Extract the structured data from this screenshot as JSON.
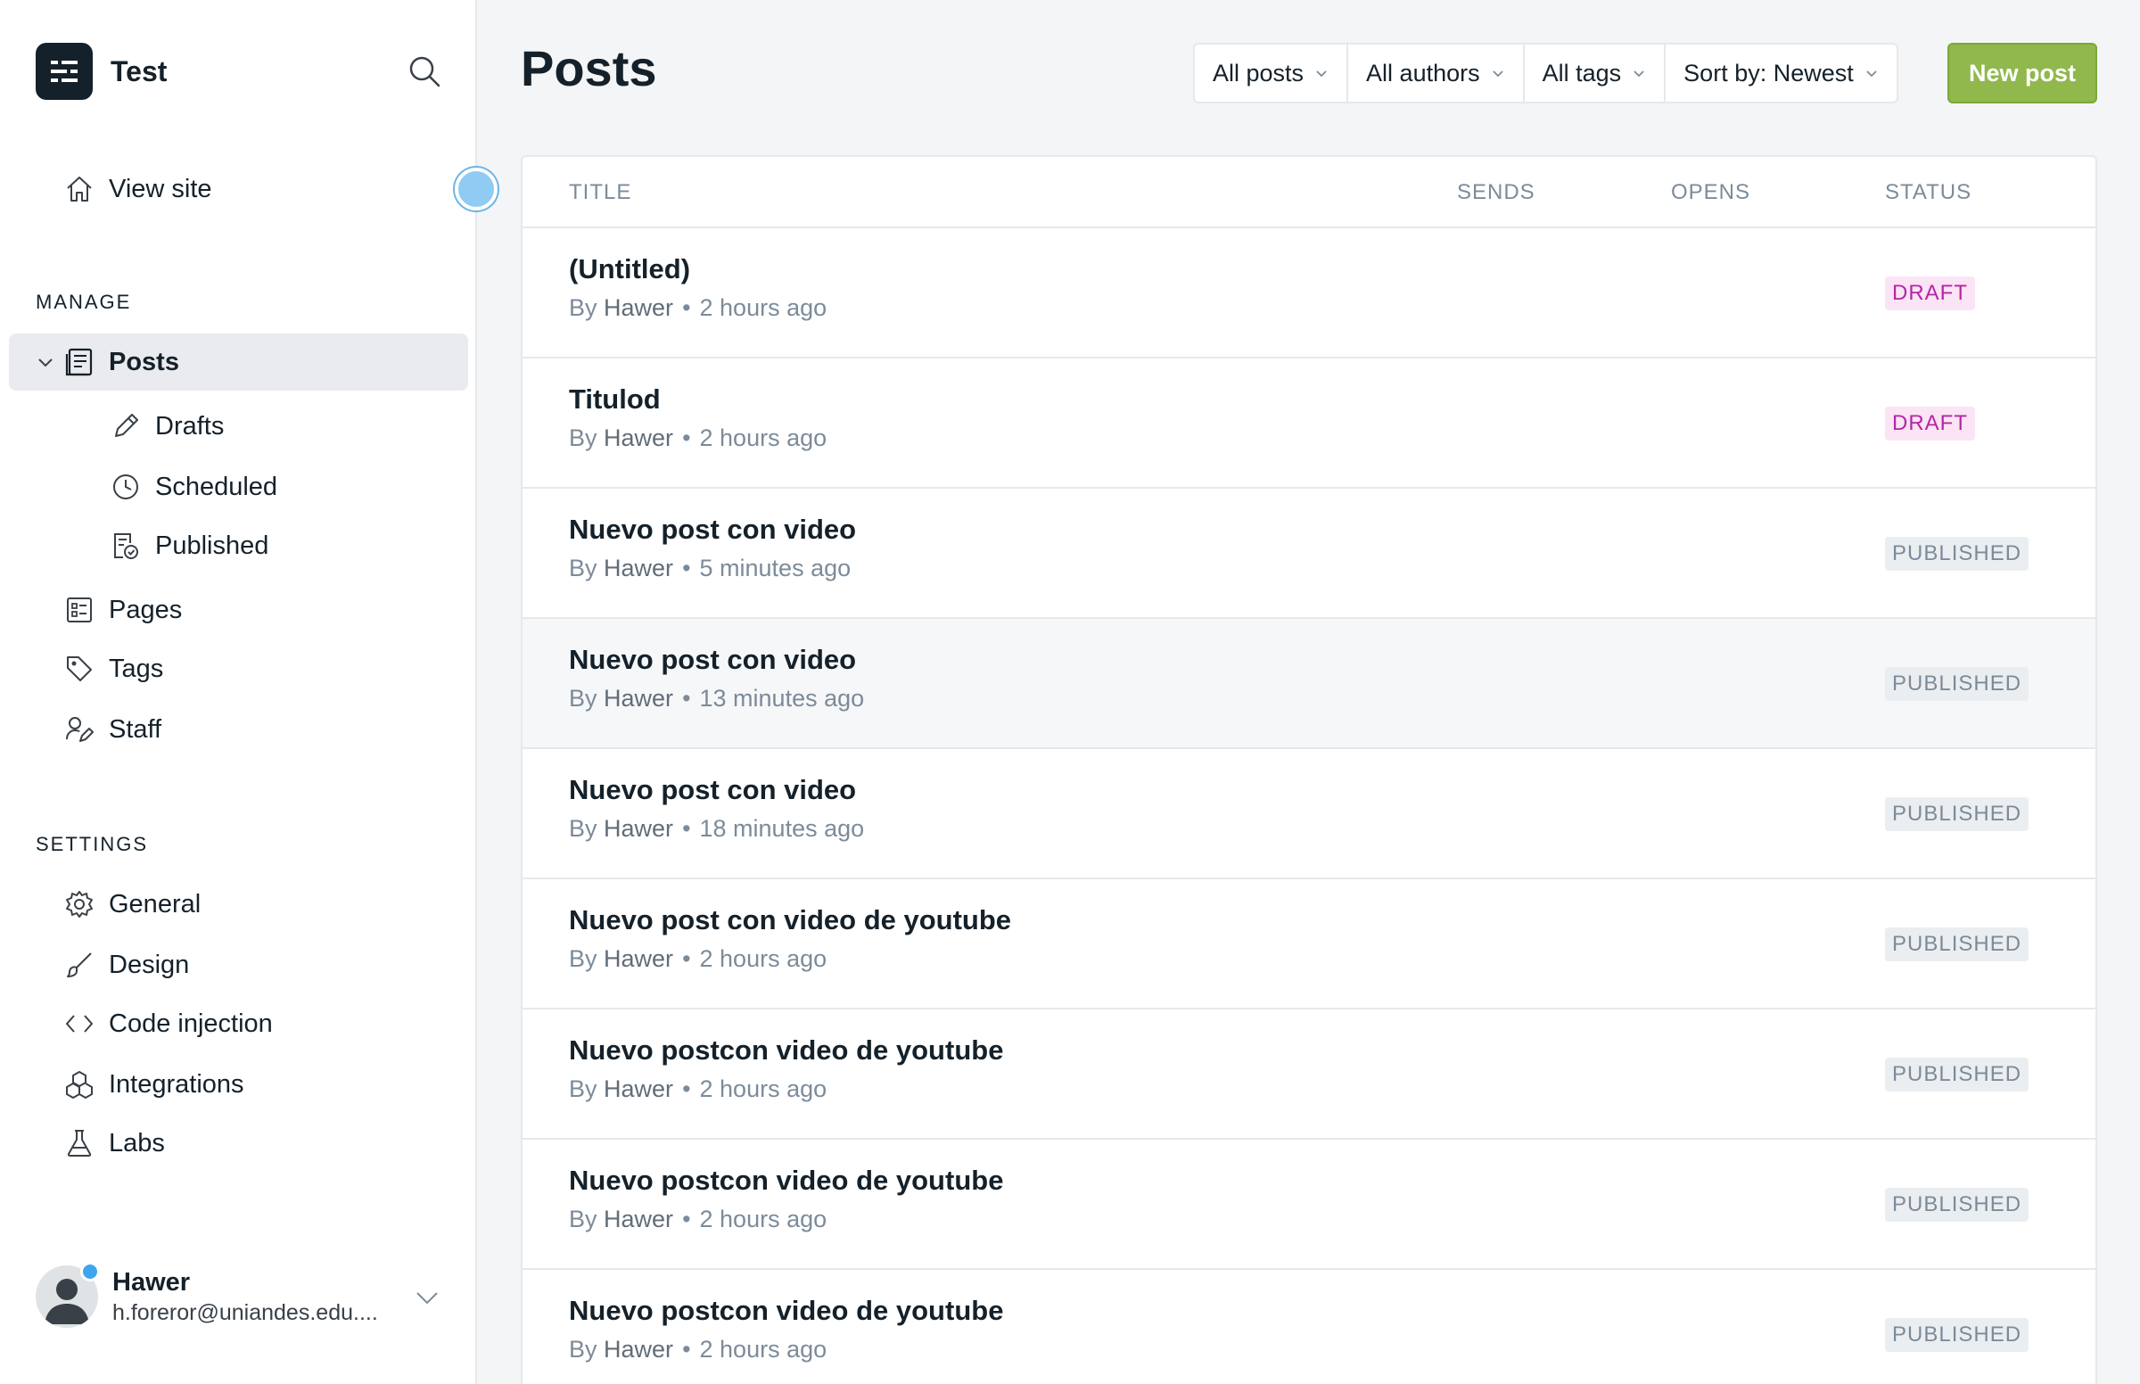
{
  "brand": {
    "name": "Test"
  },
  "nav": {
    "view_site": "View site",
    "manage_label": "MANAGE",
    "posts": "Posts",
    "drafts": "Drafts",
    "scheduled": "Scheduled",
    "published": "Published",
    "pages": "Pages",
    "tags": "Tags",
    "staff": "Staff",
    "settings_label": "SETTINGS",
    "general": "General",
    "design": "Design",
    "code_injection": "Code injection",
    "integrations": "Integrations",
    "labs": "Labs"
  },
  "user": {
    "name": "Hawer",
    "email": "h.foreror@uniandes.edu...."
  },
  "header": {
    "title": "Posts",
    "filters": [
      "All posts",
      "All authors",
      "All tags",
      "Sort by: Newest"
    ],
    "new_post": "New post"
  },
  "table": {
    "columns": [
      "TITLE",
      "SENDS",
      "OPENS",
      "STATUS"
    ],
    "rows": [
      {
        "title": "(Untitled)",
        "by": "By",
        "author": "Hawer",
        "time": "2 hours ago",
        "status": "DRAFT"
      },
      {
        "title": "Titulod",
        "by": "By",
        "author": "Hawer",
        "time": "2 hours ago",
        "status": "DRAFT"
      },
      {
        "title": "Nuevo post con video",
        "by": "By",
        "author": "Hawer",
        "time": "5 minutes ago",
        "status": "PUBLISHED"
      },
      {
        "title": "Nuevo post con video",
        "by": "By",
        "author": "Hawer",
        "time": "13 minutes ago",
        "status": "PUBLISHED"
      },
      {
        "title": "Nuevo post con video",
        "by": "By",
        "author": "Hawer",
        "time": "18 minutes ago",
        "status": "PUBLISHED"
      },
      {
        "title": "Nuevo post con video de youtube",
        "by": "By",
        "author": "Hawer",
        "time": "2 hours ago",
        "status": "PUBLISHED"
      },
      {
        "title": "Nuevo postcon video de youtube",
        "by": "By",
        "author": "Hawer",
        "time": "2 hours ago",
        "status": "PUBLISHED"
      },
      {
        "title": "Nuevo postcon video de youtube",
        "by": "By",
        "author": "Hawer",
        "time": "2 hours ago",
        "status": "PUBLISHED"
      },
      {
        "title": "Nuevo postcon video de youtube",
        "by": "By",
        "author": "Hawer",
        "time": "2 hours ago",
        "status": "PUBLISHED"
      }
    ]
  },
  "colors": {
    "accent_green": "#90b84c",
    "draft": "#b526a4",
    "dark": "#15212a"
  }
}
